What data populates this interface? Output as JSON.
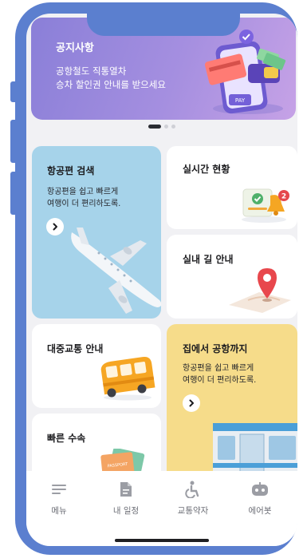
{
  "banner": {
    "title": "공지사항",
    "line1": "공항철도 직통열차",
    "line2": "승차 할인권 안내를 받으세요",
    "pay_text": "PAY"
  },
  "pager": {
    "pages": 3,
    "active": 0
  },
  "cards": {
    "flight_search": {
      "title": "항공편 검색",
      "desc1": "항공편을 쉽고 빠르게",
      "desc2": "여행이 더 편리하도록."
    },
    "realtime": {
      "title": "실시간 현황",
      "badge": "2"
    },
    "indoor": {
      "title": "실내 길 안내"
    },
    "transit": {
      "title": "대중교통 안내"
    },
    "home_to_airport": {
      "title": "집에서 공항까지",
      "desc1": "항공편을 쉽고 빠르게",
      "desc2": "여행이 더 편리하도록."
    },
    "fast_track": {
      "title": "빠른 수속",
      "passport_text": "PASSPORT"
    }
  },
  "tabs": [
    {
      "label": "메뉴",
      "icon": "menu-icon"
    },
    {
      "label": "내 일정",
      "icon": "document-icon"
    },
    {
      "label": "교통약자",
      "icon": "accessibility-icon"
    },
    {
      "label": "에어봇",
      "icon": "bot-icon"
    }
  ],
  "colors": {
    "frame": "#5b7fcf",
    "flight_card": "#a6d3ea",
    "home_card": "#f6dc8a",
    "banner_start": "#8a7fd8",
    "banner_end": "#c6a2e6"
  }
}
